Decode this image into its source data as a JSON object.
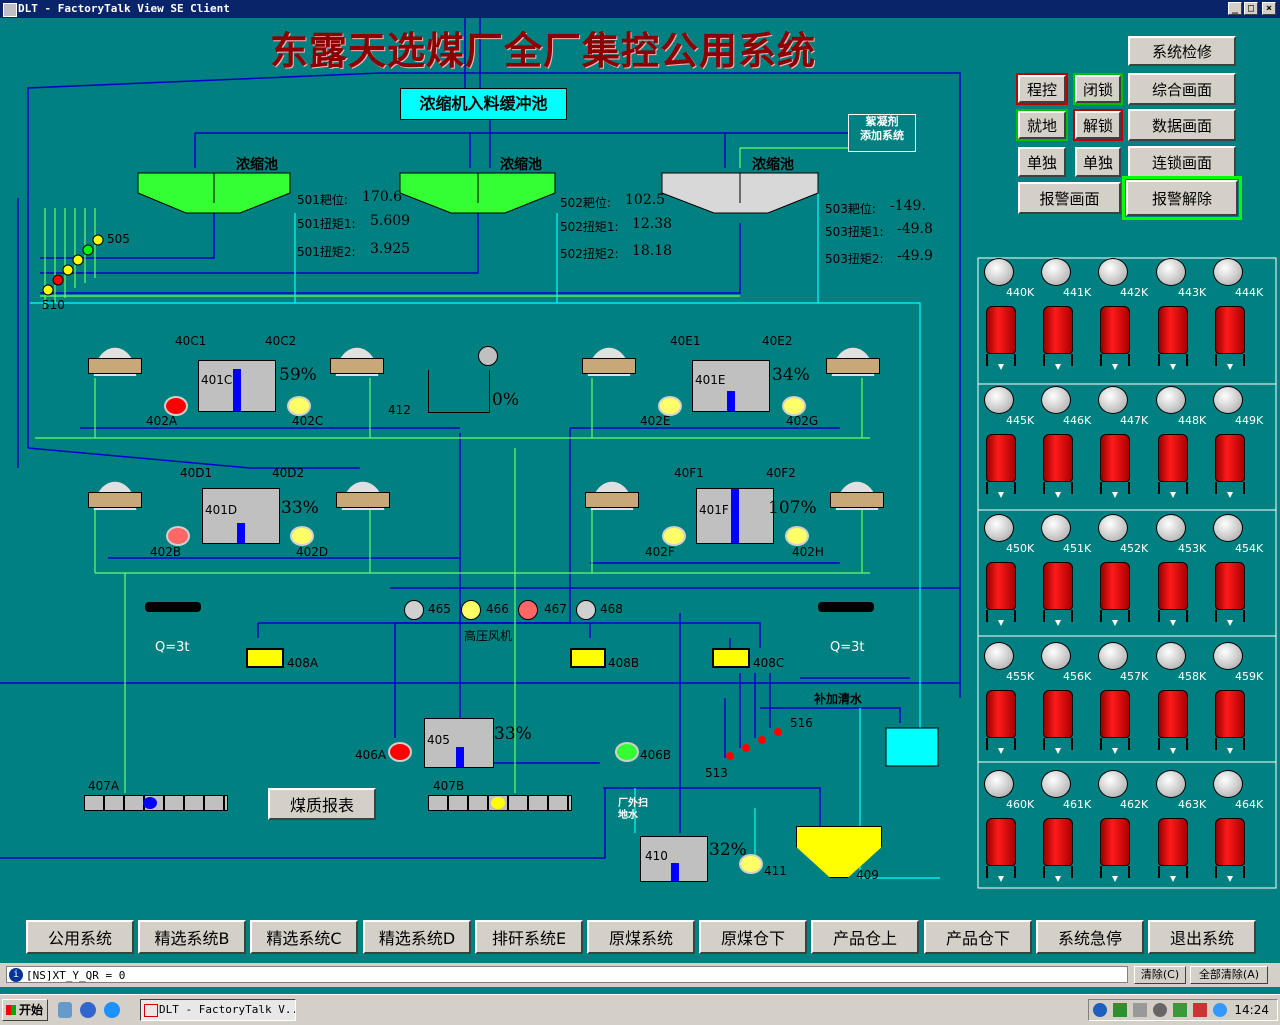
{
  "window": {
    "title": "DLT - FactoryTalk View SE Client",
    "btn_min": "_",
    "btn_max": "□",
    "btn_close": "×"
  },
  "title": "东露天选煤厂全厂集控公用系统",
  "buffer_tank": "浓缩机入料缓冲池",
  "flocculant": "絮凝剂\n添加系统",
  "thickeners": [
    {
      "name": "浓缩池",
      "rake": "501耙位:",
      "rake_v": "170.6",
      "t1": "501扭矩1:",
      "t1_v": "5.609",
      "t2": "501扭矩2:",
      "t2_v": "3.925"
    },
    {
      "name": "浓缩池",
      "rake": "502耙位:",
      "rake_v": "102.5",
      "t1": "502扭矩1:",
      "t1_v": "12.38",
      "t2": "502扭矩2:",
      "t2_v": "18.18"
    },
    {
      "name": "浓缩池",
      "rake": "503耙位:",
      "rake_v": "-149.",
      "t1": "503扭矩1:",
      "t1_v": "-49.8",
      "t2": "503扭矩2:",
      "t2_v": "-49.9"
    }
  ],
  "tags": {
    "t505": "505",
    "t510": "510",
    "c1": "40C1",
    "c2": "40C2",
    "e1": "40E1",
    "e2": "40E2",
    "d1": "40D1",
    "d2": "40D2",
    "f1": "40F1",
    "f2": "40F2",
    "a401c": "401C",
    "a401e": "401E",
    "a401d": "401D",
    "a401f": "401F",
    "p402a": "402A",
    "p402c": "402C",
    "p402e": "402E",
    "p402g": "402G",
    "p402b": "402B",
    "p402d": "402D",
    "p402f": "402F",
    "p402h": "402H",
    "t412": "412",
    "pct412": "0%",
    "pct401c": "59%",
    "pct401e": "34%",
    "pct401d": "33%",
    "pct401f": "107%",
    "f465": "465",
    "f466": "466",
    "f467": "467",
    "f468": "468",
    "blower": "高压风机",
    "t408a": "408A",
    "t408b": "408B",
    "t408c": "408C",
    "q1": "Q=3t",
    "q2": "Q=3t",
    "a405": "405",
    "pct405": "33%",
    "p406a": "406A",
    "p406b": "406B",
    "t407a": "407A",
    "t407b": "407B",
    "t516": "516",
    "t513": "513",
    "makeup": "补加清水",
    "outside": "厂外扫\n地水",
    "a410": "410",
    "pct410": "32%",
    "p411": "411",
    "t409": "409"
  },
  "report_button": "煤质报表",
  "right_buttons": {
    "system_maint": "系统检修",
    "prog": "程控",
    "lock": "闭锁",
    "overview": "综合画面",
    "local": "就地",
    "unlock": "解锁",
    "data": "数据画面",
    "single1": "单独",
    "single2": "单独",
    "interlock": "连锁画面",
    "alarm": "报警画面",
    "alarm_reset": "报警解除"
  },
  "filters": [
    [
      "440K",
      "441K",
      "442K",
      "443K",
      "444K"
    ],
    [
      "445K",
      "446K",
      "447K",
      "448K",
      "449K"
    ],
    [
      "450K",
      "451K",
      "452K",
      "453K",
      "454K"
    ],
    [
      "455K",
      "456K",
      "457K",
      "458K",
      "459K"
    ],
    [
      "460K",
      "461K",
      "462K",
      "463K",
      "464K"
    ]
  ],
  "nav": [
    "公用系统",
    "精选系统B",
    "精选系统C",
    "精选系统D",
    "排矸系统E",
    "原煤系统",
    "原煤仓下",
    "产品仓上",
    "产品仓下",
    "系统急停",
    "退出系统"
  ],
  "status": {
    "text": "[NS]XT_Y_QR = 0",
    "clear": "清除(C)",
    "clear_all": "全部清除(A)"
  },
  "taskbar": {
    "start": "开始",
    "task": "DLT - FactoryTalk V...",
    "clock": "14:24"
  },
  "colors": {
    "bg": "#008080",
    "title": "#8b0000",
    "pipe_blue": "#0000cc",
    "pipe_green": "#66ff66",
    "pipe_cyan": "#00ffff",
    "tank_red": "#dd0000"
  }
}
